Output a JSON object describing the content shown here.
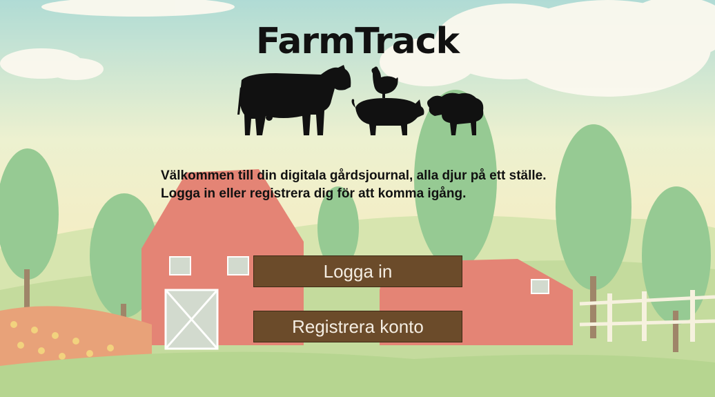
{
  "app": {
    "title": "FarmTrack"
  },
  "welcome": {
    "line1": "Välkommen till din digitala gårdsjournal, alla djur på ett ställe.",
    "line2": "Logga in eller registrera dig för att komma igång."
  },
  "buttons": {
    "login_label": "Logga in",
    "register_label": "Registrera konto"
  },
  "colors": {
    "button_bg": "#6b4b2a",
    "button_text": "#f4ede2",
    "sky": "#a9d8d0",
    "barn_red": "#d9584a"
  },
  "icons": [
    "cow-icon",
    "chicken-icon",
    "pig-icon",
    "sheep-icon"
  ]
}
